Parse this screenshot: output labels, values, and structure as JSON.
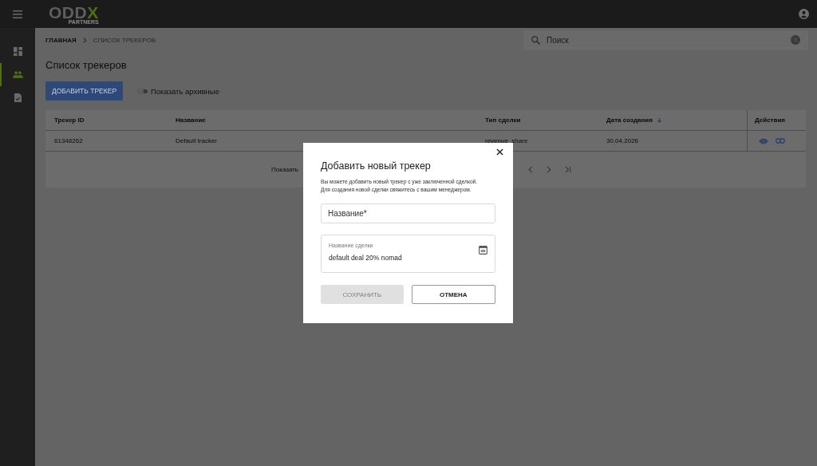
{
  "header": {
    "logo_main": "ODD",
    "logo_accent": "X",
    "logo_sub": "PARTNERS"
  },
  "sidebar": {
    "items": [
      {
        "kind": "dashboard",
        "selected": false
      },
      {
        "kind": "people",
        "selected": true
      },
      {
        "kind": "document",
        "selected": false
      }
    ]
  },
  "breadcrumbs": [
    "ГЛАВНАЯ",
    "СПИСОК ТРЕКЕРОВ"
  ],
  "search": {
    "placeholder": "Поиск"
  },
  "page_title": "Список трекеров",
  "add_button": "ДОБАВИТЬ ТРЕКЕР",
  "archive_toggle": {
    "label": "Показать архивные",
    "on": false
  },
  "table": {
    "columns": [
      {
        "label": "Трекер ID",
        "sorted": false
      },
      {
        "label": "Название",
        "sorted": false
      },
      {
        "label": "Тип сделки",
        "sorted": false
      },
      {
        "label": "Дата создания",
        "sorted": true
      },
      {
        "label": "Действия",
        "sorted": false
      }
    ],
    "rows": [
      {
        "cells": [
          "61348262",
          "Default tracker",
          "revenue_share",
          "30.04.2026"
        ]
      }
    ]
  },
  "pagination": {
    "label": "Показать"
  },
  "dialog": {
    "title": "Добавить новый трекер",
    "description": "Вы можете добавить новый трекер с уже заключенной сделкой.\nДля создания новой сделки свяжитесь с вашим менеджером.",
    "name_field": {
      "placeholder": "Название*"
    },
    "deal_field": {
      "label": "Название сделки",
      "value": "default deal 20% nomad"
    },
    "save_button": {
      "label": "СОХРАНИТЬ",
      "disabled": true
    },
    "cancel_button": {
      "label": "ОТМЕНА"
    }
  }
}
